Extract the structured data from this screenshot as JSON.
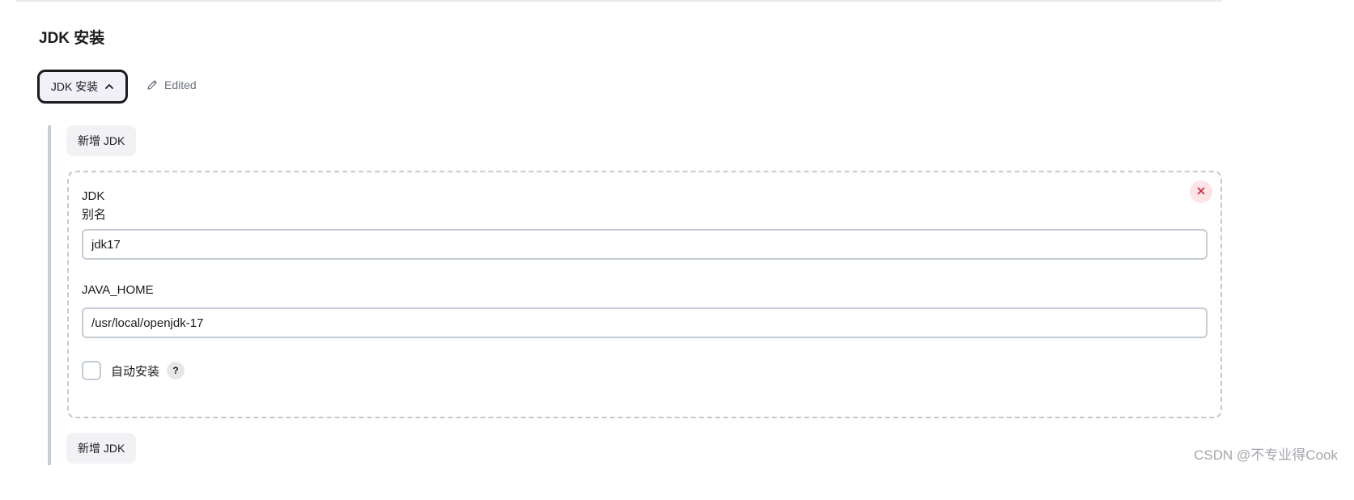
{
  "section": {
    "title": "JDK 安装"
  },
  "toggle": {
    "label": "JDK 安装",
    "icon": "chevron-up-icon"
  },
  "status": {
    "label": "Edited",
    "icon": "pencil-icon"
  },
  "add_button_label_top": "新增 JDK",
  "add_button_label_bottom": "新增 JDK",
  "jdk_entry": {
    "header_line1": "JDK",
    "header_line2": "别名",
    "alias_value": "jdk17",
    "java_home_label": "JAVA_HOME",
    "java_home_value": "/usr/local/openjdk-17",
    "auto_install_label": "自动安装",
    "auto_install_checked": false,
    "help_glyph": "?",
    "close_icon": "close-icon"
  },
  "watermark": "CSDN @不专业得Cook",
  "colors": {
    "close_bg": "#fde4e6",
    "close_fg": "#d1243b",
    "toggle_border": "#1b1b1f"
  }
}
